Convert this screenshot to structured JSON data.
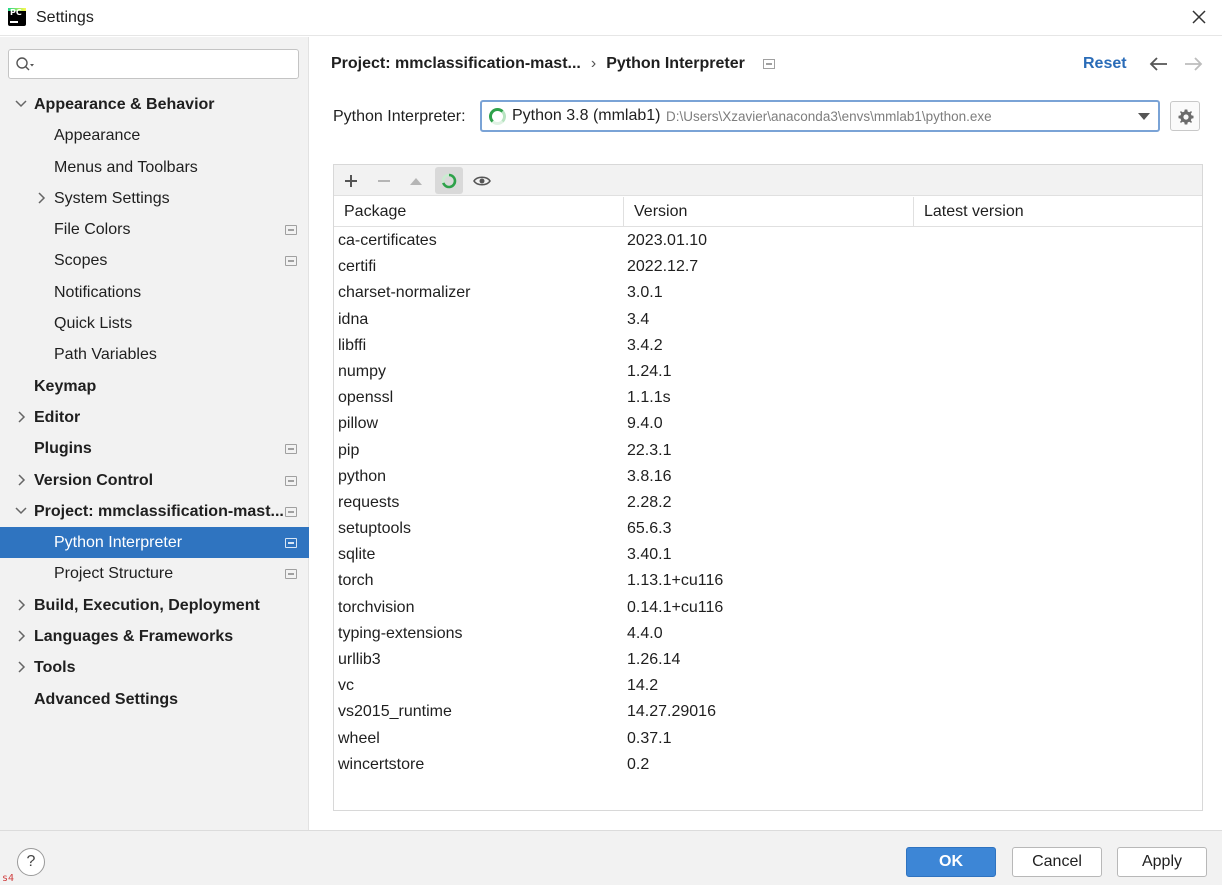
{
  "window": {
    "title": "Settings"
  },
  "search": {
    "placeholder": ""
  },
  "sidebar": {
    "items": [
      {
        "label": "Appearance & Behavior",
        "level": 0,
        "bold": true,
        "arrow": "expanded",
        "project_icon": false,
        "selected": false
      },
      {
        "label": "Appearance",
        "level": 1,
        "bold": false,
        "arrow": "none",
        "project_icon": false,
        "selected": false
      },
      {
        "label": "Menus and Toolbars",
        "level": 1,
        "bold": false,
        "arrow": "none",
        "project_icon": false,
        "selected": false
      },
      {
        "label": "System Settings",
        "level": 1,
        "bold": false,
        "arrow": "collapsed",
        "project_icon": false,
        "selected": false
      },
      {
        "label": "File Colors",
        "level": 1,
        "bold": false,
        "arrow": "none",
        "project_icon": true,
        "selected": false
      },
      {
        "label": "Scopes",
        "level": 1,
        "bold": false,
        "arrow": "none",
        "project_icon": true,
        "selected": false
      },
      {
        "label": "Notifications",
        "level": 1,
        "bold": false,
        "arrow": "none",
        "project_icon": false,
        "selected": false
      },
      {
        "label": "Quick Lists",
        "level": 1,
        "bold": false,
        "arrow": "none",
        "project_icon": false,
        "selected": false
      },
      {
        "label": "Path Variables",
        "level": 1,
        "bold": false,
        "arrow": "none",
        "project_icon": false,
        "selected": false
      },
      {
        "label": "Keymap",
        "level": 0,
        "bold": true,
        "arrow": "none",
        "project_icon": false,
        "selected": false
      },
      {
        "label": "Editor",
        "level": 0,
        "bold": true,
        "arrow": "collapsed",
        "project_icon": false,
        "selected": false
      },
      {
        "label": "Plugins",
        "level": 0,
        "bold": true,
        "arrow": "none",
        "project_icon": true,
        "selected": false
      },
      {
        "label": "Version Control",
        "level": 0,
        "bold": true,
        "arrow": "collapsed",
        "project_icon": true,
        "selected": false
      },
      {
        "label": "Project: mmclassification-mast...",
        "level": 0,
        "bold": true,
        "arrow": "expanded",
        "project_icon": true,
        "selected": false
      },
      {
        "label": "Python Interpreter",
        "level": 1,
        "bold": false,
        "arrow": "none",
        "project_icon": true,
        "selected": true
      },
      {
        "label": "Project Structure",
        "level": 1,
        "bold": false,
        "arrow": "none",
        "project_icon": true,
        "selected": false
      },
      {
        "label": "Build, Execution, Deployment",
        "level": 0,
        "bold": true,
        "arrow": "collapsed",
        "project_icon": false,
        "selected": false
      },
      {
        "label": "Languages & Frameworks",
        "level": 0,
        "bold": true,
        "arrow": "collapsed",
        "project_icon": false,
        "selected": false
      },
      {
        "label": "Tools",
        "level": 0,
        "bold": true,
        "arrow": "collapsed",
        "project_icon": false,
        "selected": false
      },
      {
        "label": "Advanced Settings",
        "level": 0,
        "bold": true,
        "arrow": "none",
        "project_icon": false,
        "selected": false
      }
    ]
  },
  "header": {
    "breadcrumb_project": "Project: mmclassification-mast...",
    "breadcrumb_separator": "›",
    "breadcrumb_page": "Python Interpreter",
    "reset_label": "Reset"
  },
  "interpreter": {
    "label": "Python Interpreter:",
    "name": "Python 3.8 (mmlab1)",
    "path": "D:\\Users\\Xzavier\\anaconda3\\envs\\mmlab1\\python.exe"
  },
  "packages": {
    "toolbar": [
      "add-icon",
      "remove-icon",
      "upgrade-icon",
      "refresh-spinner-icon",
      "eye-icon"
    ],
    "columns": [
      "Package",
      "Version",
      "Latest version"
    ],
    "rows": [
      {
        "name": "ca-certificates",
        "version": "2023.01.10",
        "latest": ""
      },
      {
        "name": "certifi",
        "version": "2022.12.7",
        "latest": ""
      },
      {
        "name": "charset-normalizer",
        "version": "3.0.1",
        "latest": ""
      },
      {
        "name": "idna",
        "version": "3.4",
        "latest": ""
      },
      {
        "name": "libffi",
        "version": "3.4.2",
        "latest": ""
      },
      {
        "name": "numpy",
        "version": "1.24.1",
        "latest": ""
      },
      {
        "name": "openssl",
        "version": "1.1.1s",
        "latest": ""
      },
      {
        "name": "pillow",
        "version": "9.4.0",
        "latest": ""
      },
      {
        "name": "pip",
        "version": "22.3.1",
        "latest": ""
      },
      {
        "name": "python",
        "version": "3.8.16",
        "latest": ""
      },
      {
        "name": "requests",
        "version": "2.28.2",
        "latest": ""
      },
      {
        "name": "setuptools",
        "version": "65.6.3",
        "latest": ""
      },
      {
        "name": "sqlite",
        "version": "3.40.1",
        "latest": ""
      },
      {
        "name": "torch",
        "version": "1.13.1+cu116",
        "latest": ""
      },
      {
        "name": "torchvision",
        "version": "0.14.1+cu116",
        "latest": ""
      },
      {
        "name": "typing-extensions",
        "version": "4.4.0",
        "latest": ""
      },
      {
        "name": "urllib3",
        "version": "1.26.14",
        "latest": ""
      },
      {
        "name": "vc",
        "version": "14.2",
        "latest": ""
      },
      {
        "name": "vs2015_runtime",
        "version": "14.27.29016",
        "latest": ""
      },
      {
        "name": "wheel",
        "version": "0.37.1",
        "latest": ""
      },
      {
        "name": "wincertstore",
        "version": "0.2",
        "latest": ""
      }
    ]
  },
  "footer": {
    "help_label": "?",
    "ok_label": "OK",
    "cancel_label": "Cancel",
    "apply_label": "Apply",
    "corner_text": "s4"
  },
  "colors": {
    "accent": "#2f74c0",
    "ok_button": "#3d86d6",
    "link": "#2a6cb8",
    "sidebar_bg": "#f2f2f2",
    "spinner": "#2ea14a"
  }
}
